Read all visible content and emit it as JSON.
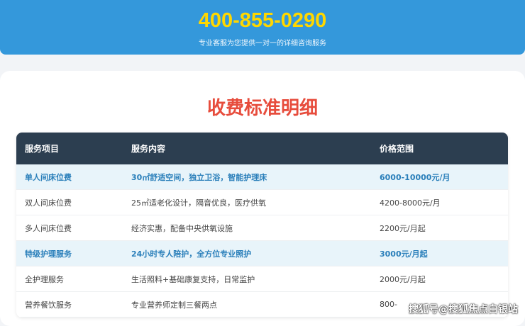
{
  "banner": {
    "phone": "400-855-0290",
    "subtitle": "专业客服为您提供一对一的详细咨询服务"
  },
  "title": "收费标准明细",
  "table": {
    "headers": [
      "服务项目",
      "服务内容",
      "价格范围"
    ],
    "rows": [
      {
        "item": "单人间床位费",
        "content": "30㎡舒适空间，独立卫浴，智能护理床",
        "price": "6000-10000元/月",
        "highlight": true
      },
      {
        "item": "双人间床位费",
        "content": "25㎡适老化设计，隔音优良，医疗供氧",
        "price": "4200-8000元/月",
        "highlight": false
      },
      {
        "item": "多人间床位费",
        "content": "经济实惠，配备中央供氧设施",
        "price": "2200元/月起",
        "highlight": false
      },
      {
        "item": "特级护理服务",
        "content": "24小时专人陪护，全方位专业照护",
        "price": "3000元/月起",
        "highlight": true
      },
      {
        "item": "全护理服务",
        "content": "生活照料+基础康复支持，日常监护",
        "price": "2000元/月起",
        "highlight": false
      },
      {
        "item": "营养餐饮服务",
        "content": "专业营养师定制三餐两点",
        "price": "800-",
        "highlight": false
      }
    ]
  },
  "watermark": "搜狐号@搜狐焦点白银站"
}
